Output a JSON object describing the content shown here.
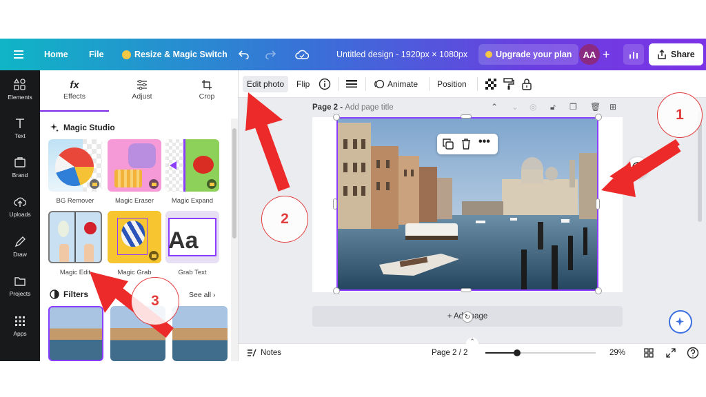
{
  "topbar": {
    "home": "Home",
    "file": "File",
    "resize": "Resize & Magic Switch",
    "doc_title": "Untitled design - 1920px × 1080px",
    "upgrade": "Upgrade your plan",
    "avatar": "AA",
    "share": "Share"
  },
  "rail": {
    "items": [
      {
        "label": "Elements",
        "icon": "elements-icon"
      },
      {
        "label": "Text",
        "icon": "text-icon"
      },
      {
        "label": "Brand",
        "icon": "brand-icon"
      },
      {
        "label": "Uploads",
        "icon": "uploads-icon"
      },
      {
        "label": "Draw",
        "icon": "draw-icon"
      },
      {
        "label": "Projects",
        "icon": "projects-icon"
      },
      {
        "label": "Apps",
        "icon": "apps-icon"
      }
    ]
  },
  "panel": {
    "tabs": [
      {
        "label": "Effects",
        "icon": "fx"
      },
      {
        "label": "Adjust"
      },
      {
        "label": "Crop"
      }
    ],
    "magic_studio": "Magic Studio",
    "tools": [
      {
        "label": "BG Remover"
      },
      {
        "label": "Magic Eraser"
      },
      {
        "label": "Magic Expand"
      },
      {
        "label": "Magic Edit"
      },
      {
        "label": "Magic Grab"
      },
      {
        "label": "Grab Text",
        "thumb_text": "Aa"
      }
    ],
    "filters": "Filters",
    "see_all": "See all"
  },
  "toolbar": {
    "edit_photo": "Edit photo",
    "flip": "Flip",
    "animate": "Animate",
    "position": "Position"
  },
  "canvas": {
    "page_label": "Page 2 -",
    "page_title_placeholder": "Add page title",
    "add_page": "+ Add page"
  },
  "footer": {
    "notes": "Notes",
    "page_counter": "Page 2 / 2",
    "zoom": "29%",
    "zoom_level": 0.29
  },
  "annotations": {
    "numbers": [
      "1",
      "2",
      "3"
    ],
    "color": "#e23b3b"
  }
}
